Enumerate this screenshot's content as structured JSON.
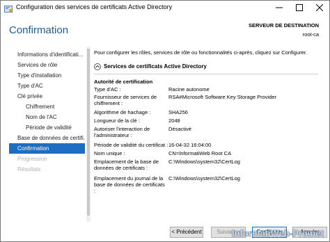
{
  "window": {
    "title": "Configuration des services de certificats Active Directory"
  },
  "header": {
    "heading": "Confirmation",
    "destination_label": "SERVEUR DE DESTINATION",
    "destination_server": "root-ca"
  },
  "sidebar": {
    "items": [
      {
        "label": "Informations d'identificati...",
        "state": "normal"
      },
      {
        "label": "Services de rôle",
        "state": "normal"
      },
      {
        "label": "Type d'installation",
        "state": "normal"
      },
      {
        "label": "Type d'AC",
        "state": "normal"
      },
      {
        "label": "Clé privée",
        "state": "normal"
      },
      {
        "label": "Chiffrement",
        "state": "sub"
      },
      {
        "label": "Nom de l'AC",
        "state": "sub"
      },
      {
        "label": "Période de validité",
        "state": "sub"
      },
      {
        "label": "Base de données de certifi...",
        "state": "normal"
      },
      {
        "label": "Confirmation",
        "state": "selected"
      },
      {
        "label": "Progression",
        "state": "disabled"
      },
      {
        "label": "Résultats",
        "state": "disabled"
      }
    ]
  },
  "main": {
    "intro": "Pour configurer les rôles, services de rôle ou fonctionnalités ci-après, cliquez sur Configurer.",
    "section_title": "Services de certificats Active Directory",
    "group_title": "Autorité de certification",
    "rows": [
      {
        "key": "Type d'AC :",
        "value": "Racine autonome"
      },
      {
        "key": "Fournisseur de services de chiffrement :",
        "value": "RSA#Microsoft Software Key Storage Provider"
      },
      {
        "key": "Algorithme de hachage :",
        "value": "SHA256"
      },
      {
        "key": "Longueur de la clé :",
        "value": "2048"
      },
      {
        "key": "Autoriser l'interaction de l'administrateur :",
        "value": "Désactivé"
      },
      {
        "key": "Période de validité du certificat :",
        "value": "16-04-32 16:04:00"
      },
      {
        "key": "Nom unique :",
        "value": "CN=InformatiWeb Root CA"
      },
      {
        "key": "Emplacement de la base de données de certificats :",
        "value": "C:\\Windows\\system32\\CertLog"
      },
      {
        "key": "Emplacement du journal de la base de données de certificats :",
        "value": "C:\\Windows\\system32\\CertLog"
      }
    ]
  },
  "buttons": {
    "previous": "< Précédent",
    "next": "Suivant >",
    "configure": "Configurer",
    "cancel": "Annuler"
  },
  "watermark": "InformatiWeb-Pro.net",
  "colors": {
    "accent": "#1d6dc3",
    "heading": "#1e5c99"
  },
  "icons": {
    "app": "certificate-services-icon",
    "section": "chevron-up-icon"
  }
}
